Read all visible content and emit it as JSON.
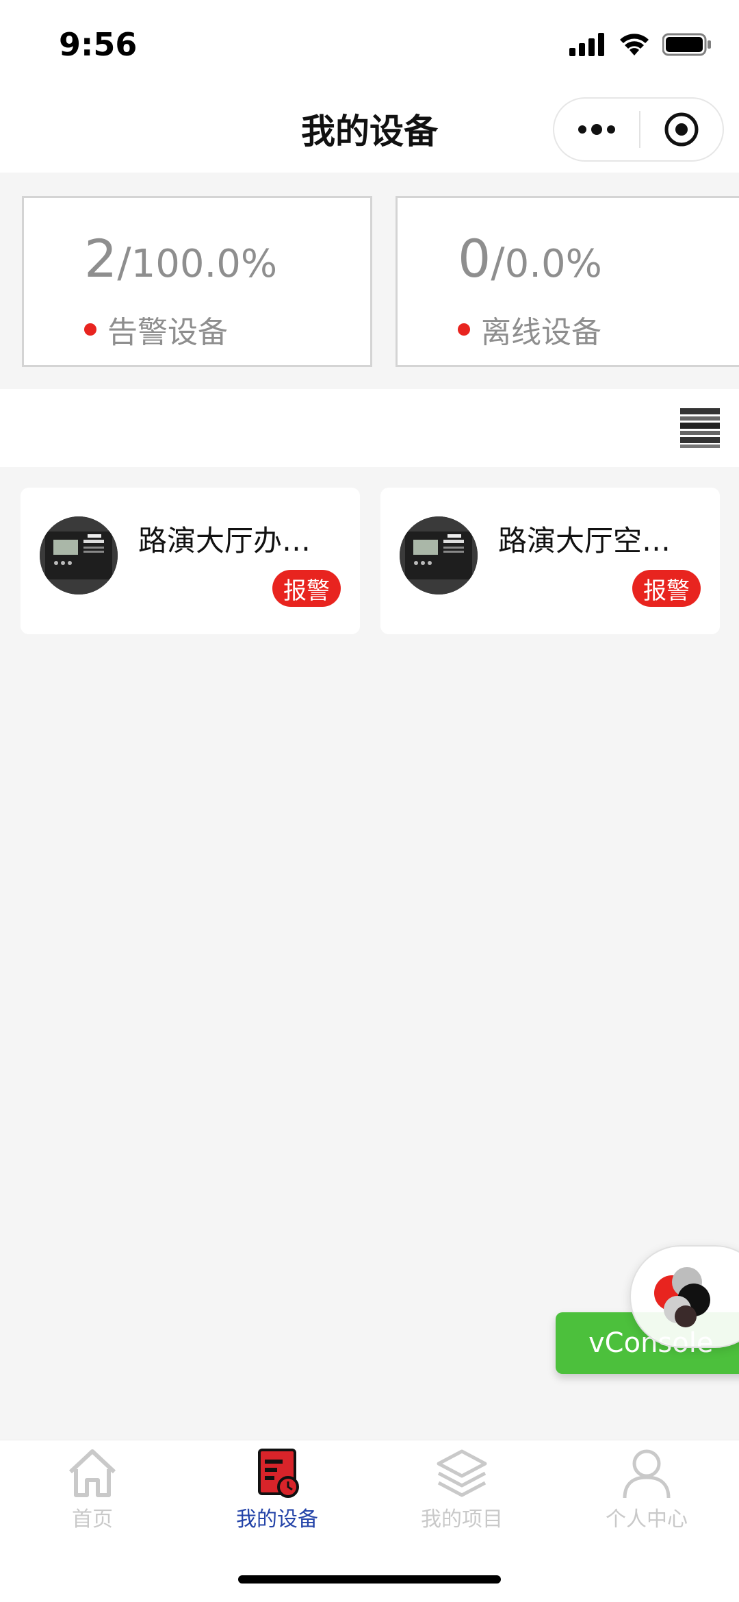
{
  "status_bar": {
    "time": "9:56"
  },
  "nav": {
    "title": "我的设备"
  },
  "stats": [
    {
      "count": "2",
      "percent": "100.0%",
      "label": "告警设备"
    },
    {
      "count": "0",
      "percent": "0.0%",
      "label": "离线设备"
    }
  ],
  "devices": [
    {
      "name": "路演大厅办…",
      "status": "报警"
    },
    {
      "name": "路演大厅空…",
      "status": "报警"
    }
  ],
  "floating": {
    "vconsole_label": "vConsole"
  },
  "tabs": [
    {
      "label": "首页",
      "icon": "home-icon",
      "active": false
    },
    {
      "label": "我的设备",
      "icon": "device-icon",
      "active": true
    },
    {
      "label": "我的项目",
      "icon": "layers-icon",
      "active": false
    },
    {
      "label": "个人中心",
      "icon": "user-icon",
      "active": false
    }
  ],
  "colors": {
    "alert_red": "#e8241f",
    "active_tab": "#2343a8",
    "vconsole_green": "#4cc03c",
    "stat_text": "#8e8e8e"
  }
}
